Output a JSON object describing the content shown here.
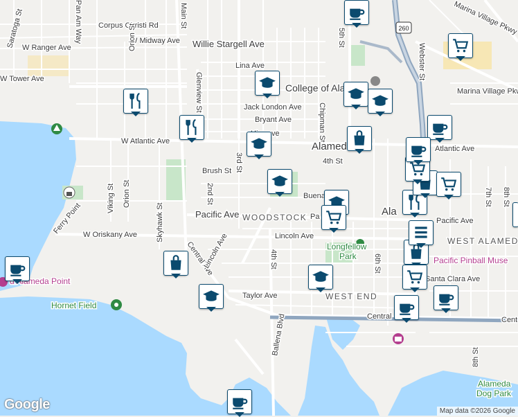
{
  "map": {
    "colors": {
      "water": "#aadaff",
      "park": "#c8e6c9",
      "land": "#f2f1ee",
      "road": "#ffffff",
      "highway": "#8fa6bf",
      "marker": "#0b4a6e"
    },
    "streets": {
      "corpus_christi": "Corpus Christi Rd",
      "midway": "W Midway Ave",
      "stargell": "Willie Stargell Ave",
      "ranger": "W Ranger Ave",
      "tower": "W Tower Ave",
      "lina": "Lina Ave",
      "jack_london": "Jack London Ave",
      "bryant": "Bryant Ave",
      "atlantic_w": "W Atlantic Ave",
      "atlantic_e": "Atlantic Ave",
      "brush": "Brush St",
      "pacific_w": "Pacific Ave",
      "pacific_e": "Pacific Ave",
      "oriskany": "W Oriskany Ave",
      "lincoln_w": "Lincoln Ave",
      "lincoln_e": "Lincoln Ave",
      "taylor": "Taylor Ave",
      "santa_clara": "Santa Clara Ave",
      "central_w": "Central Ave",
      "central_e": "Central",
      "central_far": "Cent",
      "main": "Main St",
      "glenview": "Glenview St",
      "second": "2nd St",
      "third": "3rd St",
      "fourth": "4th St",
      "fifth": "5th St",
      "sixth": "6th St",
      "seventh": "7th St",
      "eighth_top": "8th St",
      "eighth_bot": "8th St",
      "webster": "Webster St",
      "marina_village": "Marina Village Pkwy",
      "marina_village_pkwy": "Marina Village Pkwy",
      "chipman": "Chipman St",
      "orion1": "Orion St",
      "orion2": "Orion St",
      "viking": "Viking St",
      "skyhawk": "Skyhawk St",
      "saratoga": "Saratoga St",
      "pan_am": "Pan Am Way",
      "ferry_point": "Ferry Point",
      "ballena": "Ballena Blvd",
      "buena_vista": "Buena",
      "ve": "ve",
      "pacific_frag": "Pa",
      "hw_label": "Hi"
    },
    "places": {
      "college": "College of Alam",
      "alameda": "Alamed",
      "alameda2": "Ala",
      "woodstock": "WOODSTOCK",
      "west_alameda": "WEST ALAMED",
      "west_end": "WEST END",
      "longfellow_1": "Longfellow",
      "longfellow_2": "Park",
      "pinball": "Pacific Pinball Muse",
      "alameda_point": "d Alameda Point",
      "hornet_field": "Hornet Field",
      "dog_park_1": "Alameda",
      "dog_park_2": "Dog Park"
    },
    "highway_shield": "260",
    "google_logo": "Google",
    "attribution": "Map data ©2026 Google"
  }
}
